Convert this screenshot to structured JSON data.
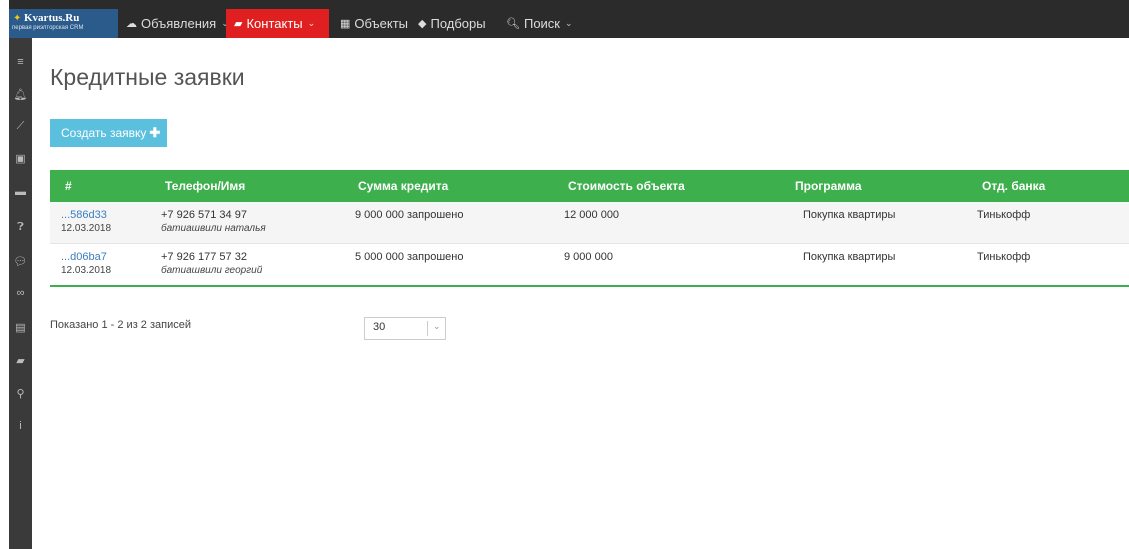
{
  "brand": {
    "title": "Kvartus.Ru",
    "subtitle": "первая риэлторская CRM"
  },
  "nav": [
    {
      "label": "Объявления",
      "icon": "cloud-icon",
      "active": false
    },
    {
      "label": "Контакты",
      "icon": "book-icon",
      "active": true
    },
    {
      "label": "Объекты",
      "icon": "building-icon",
      "active": false
    },
    {
      "label": "Подборы",
      "icon": "tag-icon",
      "active": false
    },
    {
      "label": "Поиск",
      "icon": "search-icon",
      "active": false
    }
  ],
  "sidebar_icons": [
    "menu-icon",
    "bell-icon",
    "chart-icon",
    "money-icon",
    "folder-icon",
    "help-icon",
    "chat-icon",
    "binoculars-icon",
    "newspaper-icon",
    "book-icon",
    "map-marker-icon",
    "info-icon"
  ],
  "page": {
    "title": "Кредитные заявки",
    "create_label": "Создать заявку"
  },
  "table": {
    "headers": [
      "#",
      "Телефон/Имя",
      "Сумма кредита",
      "Стоимость объекта",
      "Программа",
      "Отд. банка"
    ],
    "rows": [
      {
        "id": "...586d33",
        "date": "12.03.2018",
        "phone": "+7 926 571 34 97",
        "name": "батиашвили наталья",
        "credit": "9 000 000 запрошено",
        "price": "12 000 000",
        "program": "Покупка квартиры",
        "bank": "Тинькофф"
      },
      {
        "id": "...d06ba7",
        "date": "12.03.2018",
        "phone": "+7 926 177 57 32",
        "name": "батиашвили георгий",
        "credit": "5 000 000 запрошено",
        "price": "9 000 000",
        "program": "Покупка квартиры",
        "bank": "Тинькофф"
      }
    ]
  },
  "footer": {
    "summary": "Показано 1 - 2 из 2 записей",
    "page_size": "30"
  }
}
